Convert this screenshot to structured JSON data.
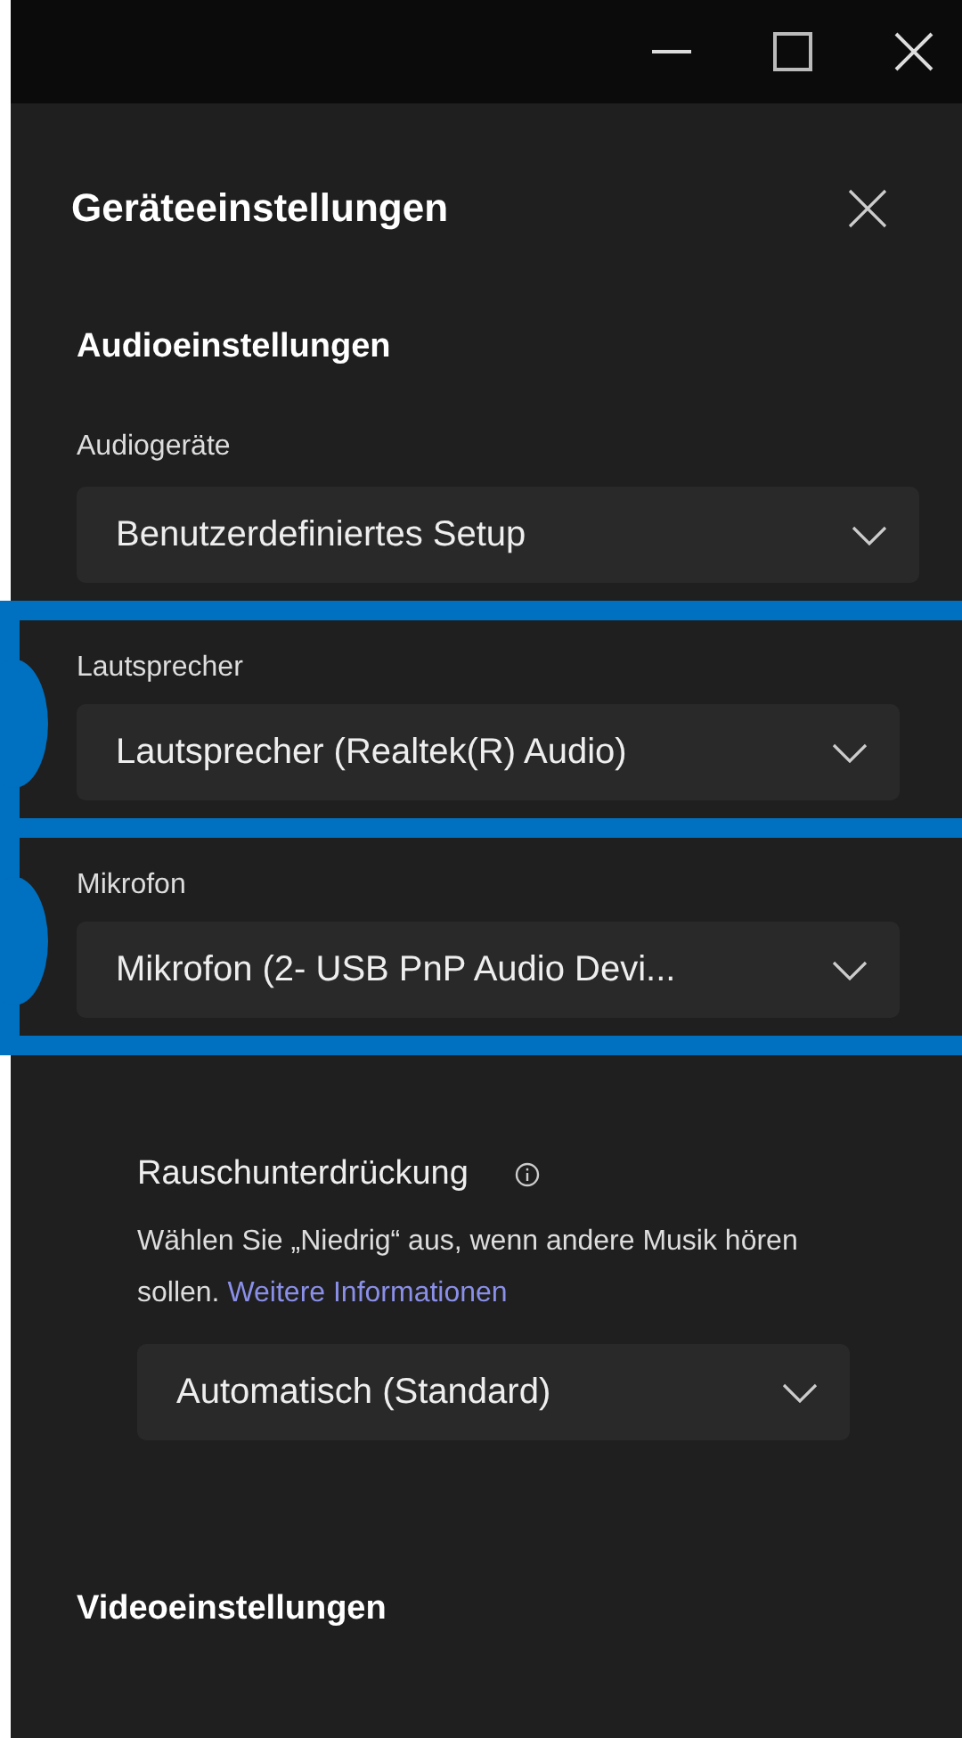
{
  "panel": {
    "title": "Geräteeinstellungen"
  },
  "audio_settings": {
    "heading": "Audioeinstellungen",
    "fields": [
      {
        "label": "Audiogeräte",
        "value": "Benutzerdefiniertes Setup",
        "highlighted": false
      },
      {
        "label": "Lautsprecher",
        "value": "Lautsprecher (Realtek(R) Audio)",
        "highlighted": true
      },
      {
        "label": "Mikrofon",
        "value": "Mikrofon (2- USB PnP Audio Devi...",
        "highlighted": true
      }
    ]
  },
  "noise_suppression": {
    "label": "Rauschunterdrückung",
    "description": "Wählen Sie „Niedrig“ aus, wenn andere Musik hören sollen.",
    "link": "Weitere Informationen",
    "value": "Automatisch (Standard)"
  },
  "video_settings": {
    "heading": "Videoeinstellungen"
  }
}
